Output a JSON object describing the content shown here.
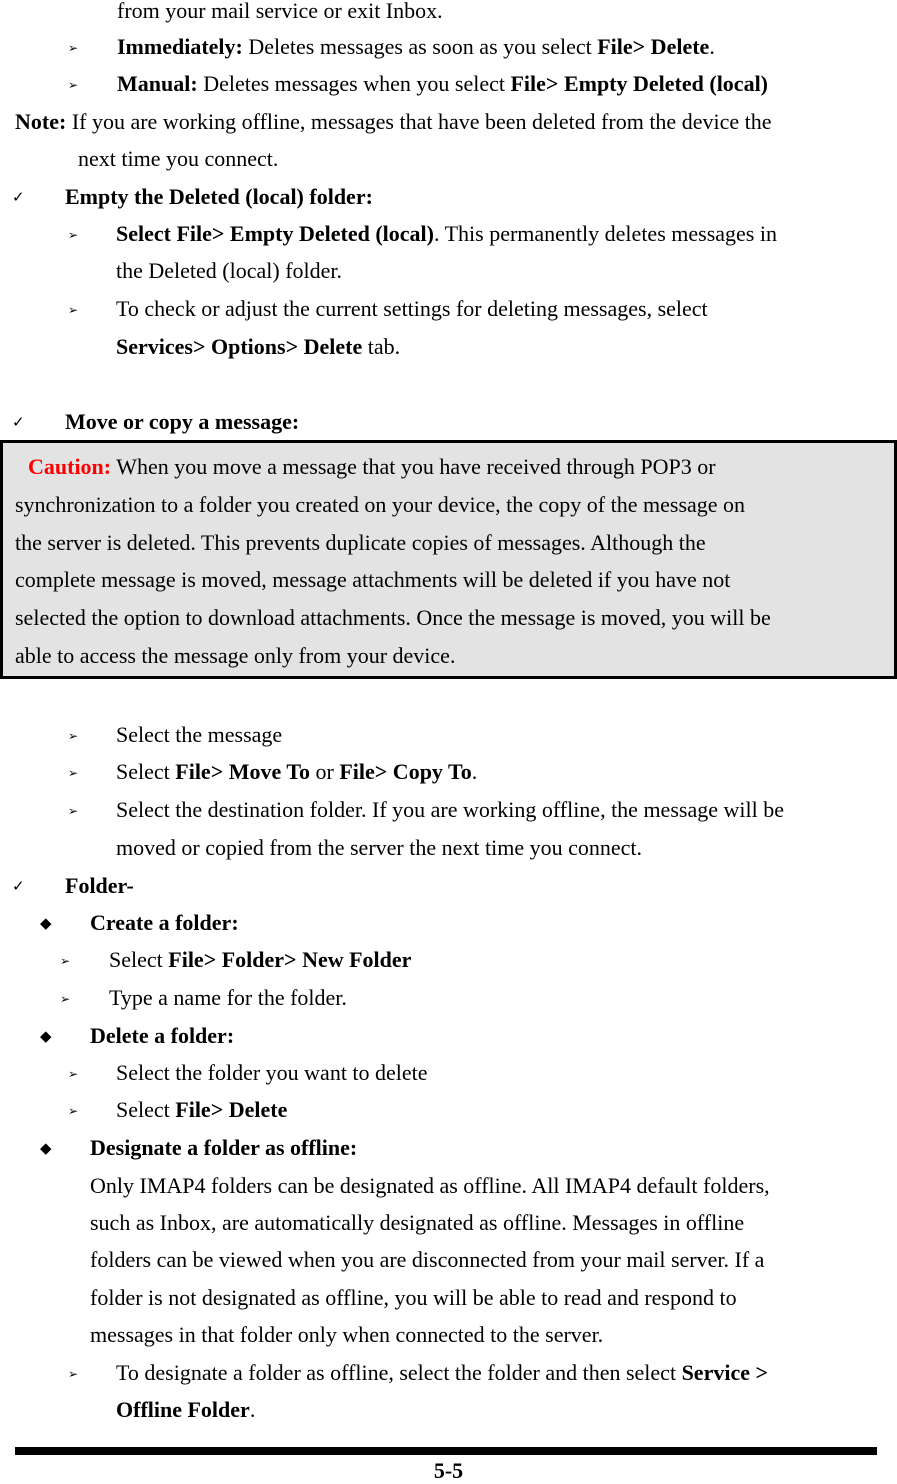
{
  "top": {
    "continued": "from your mail service or exit Inbox.",
    "immediately": {
      "label": "Immediately:",
      "text": " Deletes messages as soon as you select ",
      "cmd": "File> Delete",
      "end": "."
    },
    "manual": {
      "label": "Manual:",
      "text": " Deletes messages when you select ",
      "cmd": "File> Empty Deleted (local)"
    },
    "note": {
      "label": "Note:",
      "text": " If you are working offline, messages that have been deleted from the device the",
      "text2": "next time you connect."
    }
  },
  "empty_section": {
    "heading": "Empty the Deleted (local) folder:",
    "step1": {
      "cmd": "Select File> Empty Deleted (local)",
      "text": ". This permanently deletes messages in",
      "text2": "the Deleted (local) folder."
    },
    "step2": {
      "text": "To check or adjust the current settings for deleting messages, select",
      "cmd": "Services> Options> Delete",
      "end": " tab."
    }
  },
  "move_section": {
    "heading": "Move or copy a message:",
    "caution": {
      "label": "Caution:",
      "lines": [
        " When you move a message that you have received through POP3 or",
        "synchronization to a folder you created on your device, the copy of the message on",
        "the server is deleted. This prevents duplicate copies of messages. Although the",
        "complete message is moved, message attachments will be deleted if you have not",
        "selected the option to download attachments. Once the message is moved, you will be",
        "able to access the message only from your device."
      ]
    },
    "step1": "Select the message",
    "step2": {
      "pre": "Select ",
      "cmd1": "File> Move To",
      "mid": " or ",
      "cmd2": "File> Copy To",
      "end": "."
    },
    "step3": {
      "text": "Select the destination folder. If you are working offline, the message will be",
      "text2": "moved or copied from the server the next time you connect."
    }
  },
  "folder_section": {
    "heading": "Folder-",
    "create": {
      "heading": "Create a folder:",
      "step1_pre": "Select ",
      "step1_cmd": "File> Folder> New Folder",
      "step2": "Type a name for the folder."
    },
    "delete": {
      "heading": "Delete a folder:",
      "step1": "Select the folder you want to delete",
      "step2_pre": "Select ",
      "step2_cmd": "File> Delete"
    },
    "offline": {
      "heading": "Designate a folder as offline:",
      "para": [
        "Only IMAP4 folders can be designated as offline. All IMAP4 default folders,",
        "such as Inbox, are automatically designated as offline. Messages in offline",
        "folders can be viewed when you are disconnected from your mail server. If a",
        "folder is not designated as offline, you will be able to read and respond to",
        "messages in that folder only when connected to the server."
      ],
      "step": {
        "text": "To designate a folder as offline, select the folder and then select ",
        "cmd": "Service >",
        "cmd2": "Offline Folder",
        "end": "."
      }
    }
  },
  "footer": {
    "page_number": "5-5"
  },
  "icons": {
    "arrow": "➢",
    "check": "✓",
    "diamond": "◆"
  }
}
